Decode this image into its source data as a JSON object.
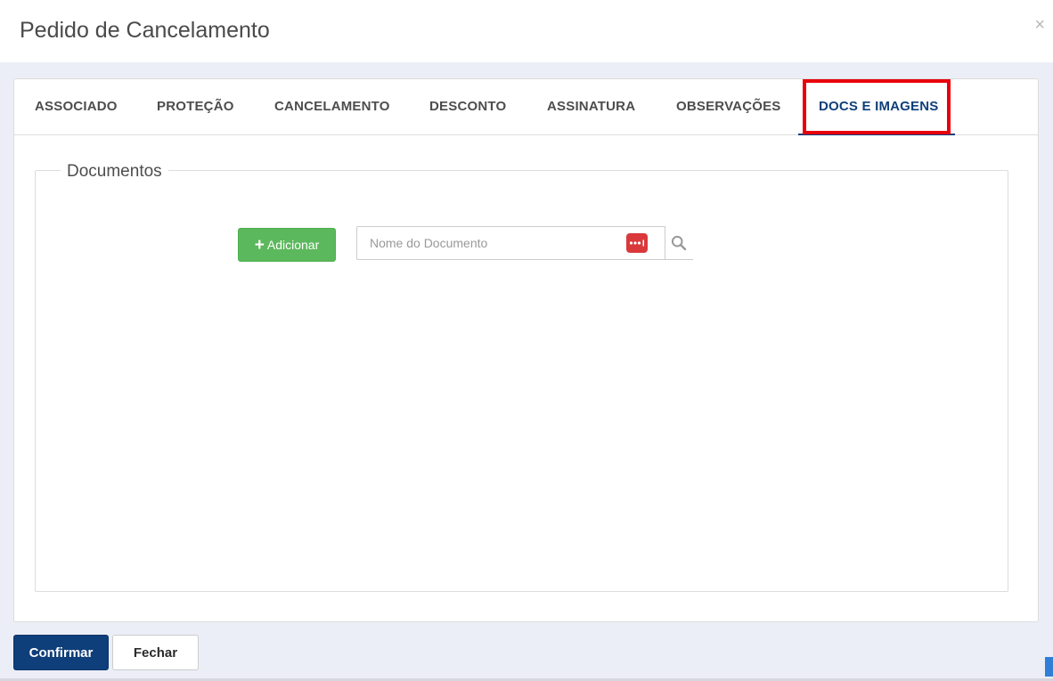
{
  "modal": {
    "title": "Pedido de Cancelamento",
    "close_symbol": "×"
  },
  "tabs": [
    {
      "label": "ASSOCIADO",
      "active": false
    },
    {
      "label": "PROTEÇÃO",
      "active": false
    },
    {
      "label": "CANCELAMENTO",
      "active": false
    },
    {
      "label": "DESCONTO",
      "active": false
    },
    {
      "label": "ASSINATURA",
      "active": false
    },
    {
      "label": "OBSERVAÇÕES",
      "active": false
    },
    {
      "label": "DOCS E IMAGENS",
      "active": true
    }
  ],
  "documents": {
    "legend": "Documentos",
    "add_button_label": "Adicionar",
    "add_icon": "plus-icon",
    "search_placeholder": "Nome do Documento",
    "search_value": "",
    "password_manager_icon": "password-dots-icon",
    "search_icon": "magnifier-icon"
  },
  "footer": {
    "confirm_label": "Confirmar",
    "close_label": "Fechar"
  },
  "colors": {
    "primary": "#0f3f7a",
    "success": "#5cb85c",
    "highlight": "#e8000b",
    "background": "#eceef7"
  }
}
